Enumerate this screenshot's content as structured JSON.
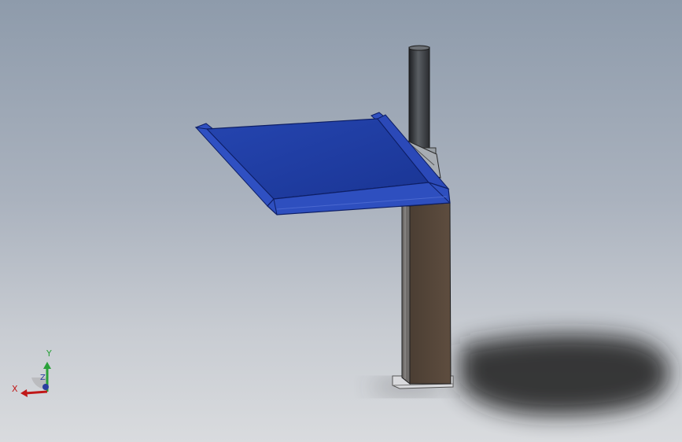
{
  "viewport": {
    "background_top": "#8e9bab",
    "background_bottom": "#d9dbde"
  },
  "model": {
    "plate_color": "#1f3a9c",
    "plate_edge_color": "#14297a",
    "post_color": "#554639",
    "column_color": "#2f3236",
    "shadow_color": "#1a1a1a"
  },
  "triad": {
    "x_label": "X",
    "y_label": "Y",
    "z_label": "Z",
    "x_color": "#c01818",
    "y_color": "#2aa13a",
    "z_color": "#2b3fa0"
  }
}
